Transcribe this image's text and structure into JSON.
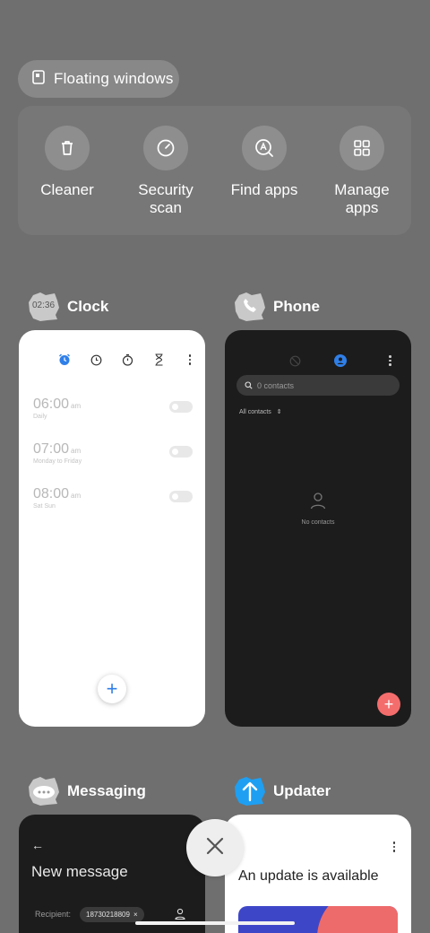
{
  "floating": {
    "label": "Floating windows",
    "icon": "floating-window-icon"
  },
  "tools": [
    {
      "label": "Cleaner",
      "icon": "trash-icon"
    },
    {
      "label": "Security\nscan",
      "icon": "security-scan-icon"
    },
    {
      "label": "Find apps",
      "icon": "find-apps-icon"
    },
    {
      "label": "Manage\napps",
      "icon": "grid-icon"
    }
  ],
  "apps": {
    "clock": {
      "name": "Clock",
      "icon_text": "02:36",
      "alarms": [
        {
          "time": "06:00",
          "ampm": "am",
          "repeat": "Daily"
        },
        {
          "time": "07:00",
          "ampm": "am",
          "repeat": "Monday to Friday"
        },
        {
          "time": "08:00",
          "ampm": "am",
          "repeat": "Sat Sun"
        }
      ],
      "fab": "+"
    },
    "phone": {
      "name": "Phone",
      "search_placeholder": "0 contacts",
      "filter": "All contacts",
      "empty": "No contacts",
      "fab": "+"
    },
    "messaging": {
      "name": "Messaging",
      "back": "←",
      "title": "New message",
      "recipient_label": "Recipient:",
      "recipient_chip": "18730218809",
      "chip_close": "×"
    },
    "updater": {
      "name": "Updater",
      "title": "An update is available"
    }
  },
  "colors": {
    "background": "#6f6f6f",
    "accent_blue": "#2f7fe8",
    "fab_red": "#f46d6d",
    "updater_blue": "#3e46c8",
    "updater_coral": "#ee6b6b"
  }
}
